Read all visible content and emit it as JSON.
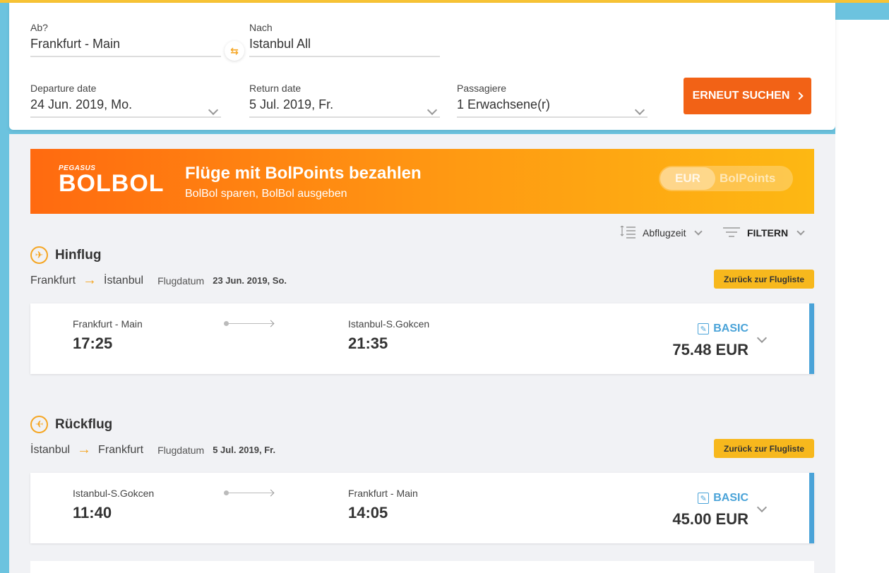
{
  "search": {
    "from_label": "Ab?",
    "from_value": "Frankfurt - Main",
    "to_label": "Nach",
    "to_value": "Istanbul All",
    "departure_label": "Departure date",
    "departure_value": "24 Jun. 2019, Mo.",
    "return_label": "Return date",
    "return_value": "5 Jul. 2019, Fr.",
    "passengers_label": "Passagiere",
    "passengers_value": "1 Erwachsene(r)",
    "search_button": "ERNEUT SUCHEN"
  },
  "banner": {
    "brand_small": "PEGASUS",
    "brand": "BOLBOL",
    "title": "Flüge mit BolPoints bezahlen",
    "subtitle": "BolBol sparen, BolBol ausgeben",
    "toggle_option_1": "EUR",
    "toggle_option_2": "BolPoints"
  },
  "toolbar": {
    "sort_label": "Abflugzeit",
    "filter_label": "FILTERN"
  },
  "outbound": {
    "title": "Hinflug",
    "route_from": "Frankfurt",
    "route_to": "İstanbul",
    "date_label": "Flugdatum",
    "date_value": "23 Jun. 2019, So.",
    "back_button": "Zurück zur Flugliste",
    "flight": {
      "from_airport": "Frankfurt - Main",
      "dep_time": "17:25",
      "to_airport": "Istanbul-S.Gokcen",
      "arr_time": "21:35",
      "fare_class": "BASIC",
      "price": "75.48 EUR"
    }
  },
  "inbound": {
    "title": "Rückflug",
    "route_from": "İstanbul",
    "route_to": "Frankfurt",
    "date_label": "Flugdatum",
    "date_value": "5 Jul. 2019, Fr.",
    "back_button": "Zurück zur Flugliste",
    "flight": {
      "from_airport": "Istanbul-S.Gokcen",
      "dep_time": "11:40",
      "to_airport": "Frankfurt - Main",
      "arr_time": "14:05",
      "fare_class": "BASIC",
      "price": "45.00 EUR"
    }
  },
  "icons": {
    "swap": "swap-arrows-icon",
    "plane": "plane-icon",
    "sort": "sort-list-icon",
    "filter": "filter-icon",
    "edit": "edit-icon"
  },
  "colors": {
    "primary_orange": "#f26216",
    "accent_yellow": "#f7b81d",
    "info_blue": "#4aa3d8"
  }
}
